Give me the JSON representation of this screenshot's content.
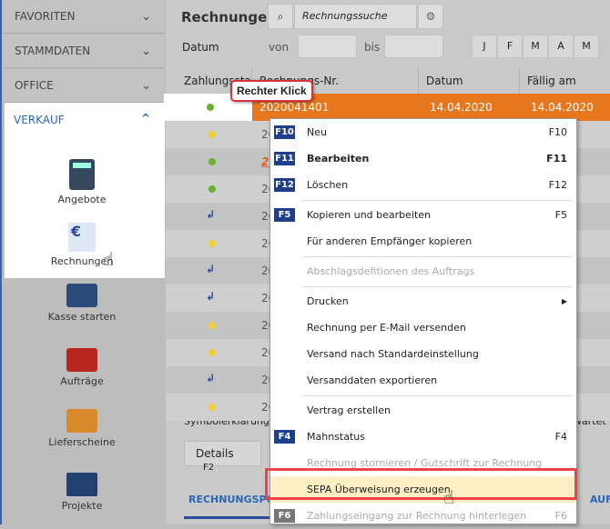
{
  "sidebar": {
    "sections": [
      {
        "label": "FAVORITEN"
      },
      {
        "label": "STAMMDATEN"
      },
      {
        "label": "OFFICE"
      }
    ],
    "active": {
      "label": "VERKAUF",
      "items": [
        {
          "label": "Angebote"
        },
        {
          "label": "Rechnungen"
        }
      ]
    },
    "more": [
      {
        "label": "Kasse starten"
      },
      {
        "label": "Aufträge"
      },
      {
        "label": "Lieferscheine"
      },
      {
        "label": "Projekte"
      }
    ]
  },
  "header": {
    "title": "Rechnungen",
    "search_placeholder": "Rechnungssuche",
    "date_label": "Datum",
    "from_label": "von",
    "to_label": "bis",
    "months": [
      "J",
      "F",
      "M",
      "A",
      "M"
    ]
  },
  "table": {
    "columns": [
      "Zahlungsstatus",
      "Rechnungs-Nr.",
      "Datum",
      "Fällig am"
    ],
    "first_row": {
      "number": "2020041401",
      "date": "14.04.2020",
      "due": "14.04.2020"
    },
    "rows": [
      {
        "s": "yellow",
        "n": "20"
      },
      {
        "s": "green",
        "n": "20",
        "overdue": true
      },
      {
        "s": "green",
        "n": "20"
      },
      {
        "s": "arrow",
        "n": "20"
      },
      {
        "s": "yellow",
        "n": "20"
      },
      {
        "s": "arrow",
        "n": "20"
      },
      {
        "s": "arrow",
        "n": "20"
      },
      {
        "s": "yellow",
        "n": "20"
      },
      {
        "s": "yellow",
        "n": "20"
      },
      {
        "s": "arrow",
        "n": "20"
      },
      {
        "s": "yellow",
        "n": "20"
      }
    ]
  },
  "legend": {
    "label": "Symbolerklärung:",
    "trailing": "wartet"
  },
  "footer": {
    "details_label": "Details",
    "details_key": "F2",
    "tab1": "RECHNUNGSPO",
    "tab2": "AUF"
  },
  "tooltip": "Rechter Klick",
  "menu": {
    "items": [
      {
        "key": "F10",
        "label": "Neu",
        "shortcut": "F10"
      },
      {
        "key": "F11",
        "label": "Bearbeiten",
        "shortcut": "F11",
        "bold": true
      },
      {
        "key": "F12",
        "label": "Löschen",
        "shortcut": "F12",
        "sep": true
      },
      {
        "key": "F5",
        "label": "Kopieren und bearbeiten",
        "shortcut": "F5"
      },
      {
        "label": "Für anderen Empfänger kopieren",
        "sep": true
      },
      {
        "label": "Abschlagsdefitionen des Auftrags",
        "disabled": true,
        "sep": true
      },
      {
        "label": "Drucken",
        "submenu": true
      },
      {
        "label": "Rechnung per E-Mail versenden"
      },
      {
        "label": "Versand nach Standardeinstellung"
      },
      {
        "label": "Versanddaten exportieren",
        "sep": true
      },
      {
        "label": "Vertrag erstellen"
      },
      {
        "key": "F4",
        "label": "Mahnstatus",
        "shortcut": "F4"
      },
      {
        "label": "Rechnung stornieren / Gutschrift zur Rechnung erstellen",
        "disabled": true
      },
      {
        "label": "SEPA Überweisung erzeugen",
        "highlighted": true
      },
      {
        "key": "F6",
        "label": "Zahlungseingang zur Rechnung hinterlegen",
        "shortcut": "F6",
        "disabled": true
      }
    ]
  },
  "colors": {
    "accent": "#e8761c",
    "blue": "#2a66b8",
    "highlight": "#fdeec4",
    "frame": "#f0424a"
  }
}
